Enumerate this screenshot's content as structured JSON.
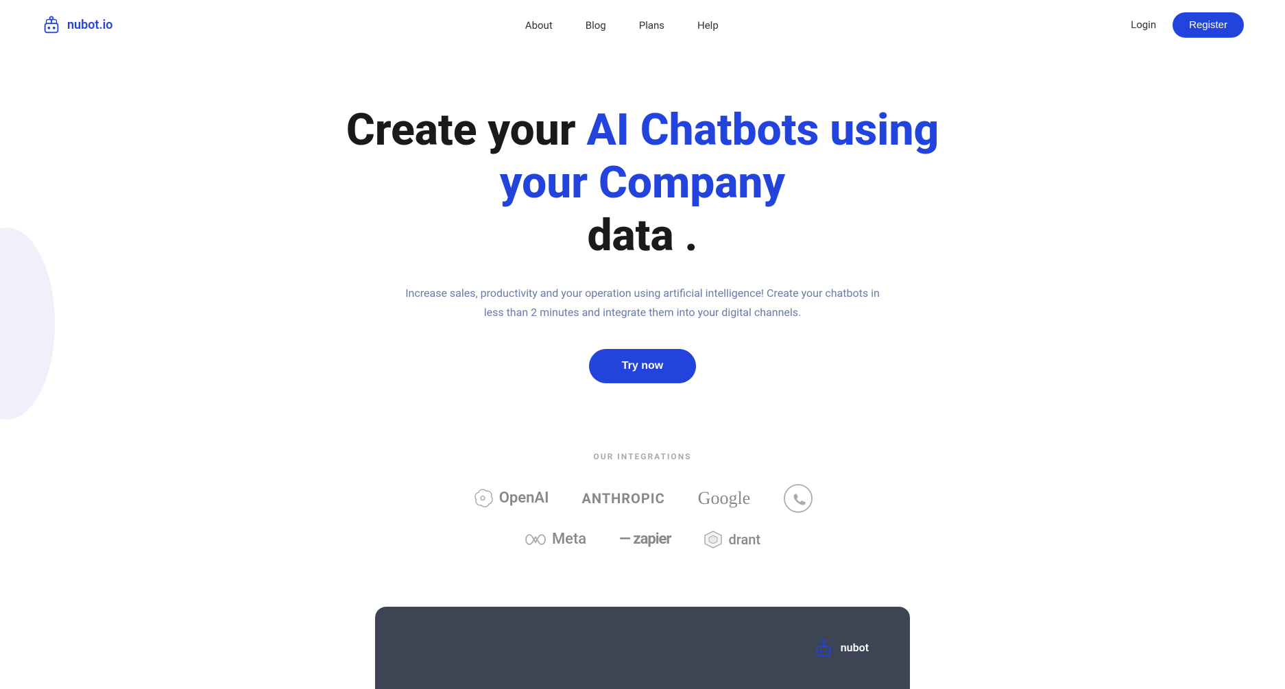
{
  "brand": {
    "name": "nubot.io"
  },
  "nav": {
    "links": [
      {
        "label": "About",
        "id": "about"
      },
      {
        "label": "Blog",
        "id": "blog"
      },
      {
        "label": "Plans",
        "id": "plans"
      },
      {
        "label": "Help",
        "id": "help"
      }
    ],
    "login_label": "Login",
    "register_label": "Register"
  },
  "hero": {
    "title_part1": "Create your ",
    "title_blue": "AI Chatbots using your Company",
    "title_part2": "data",
    "title_period": " .",
    "subtitle": "Increase sales, productivity and your operation using artificial intelligence! Create your chatbots in less than 2 minutes and integrate them into your digital channels.",
    "cta_label": "Try now"
  },
  "integrations": {
    "section_label": "OUR INTEGRATIONS",
    "row1": [
      {
        "name": "OpenAI",
        "icon": "openai"
      },
      {
        "name": "ANTHROPIC",
        "icon": "anthropic"
      },
      {
        "name": "Google",
        "icon": "google"
      },
      {
        "name": "WhatsApp",
        "icon": "whatsapp"
      }
    ],
    "row2": [
      {
        "name": "Meta",
        "icon": "meta"
      },
      {
        "name": "zapier",
        "icon": "zapier"
      },
      {
        "name": "qdrant",
        "icon": "qdrant"
      }
    ]
  },
  "preview": {
    "logo_text": "nubot"
  }
}
